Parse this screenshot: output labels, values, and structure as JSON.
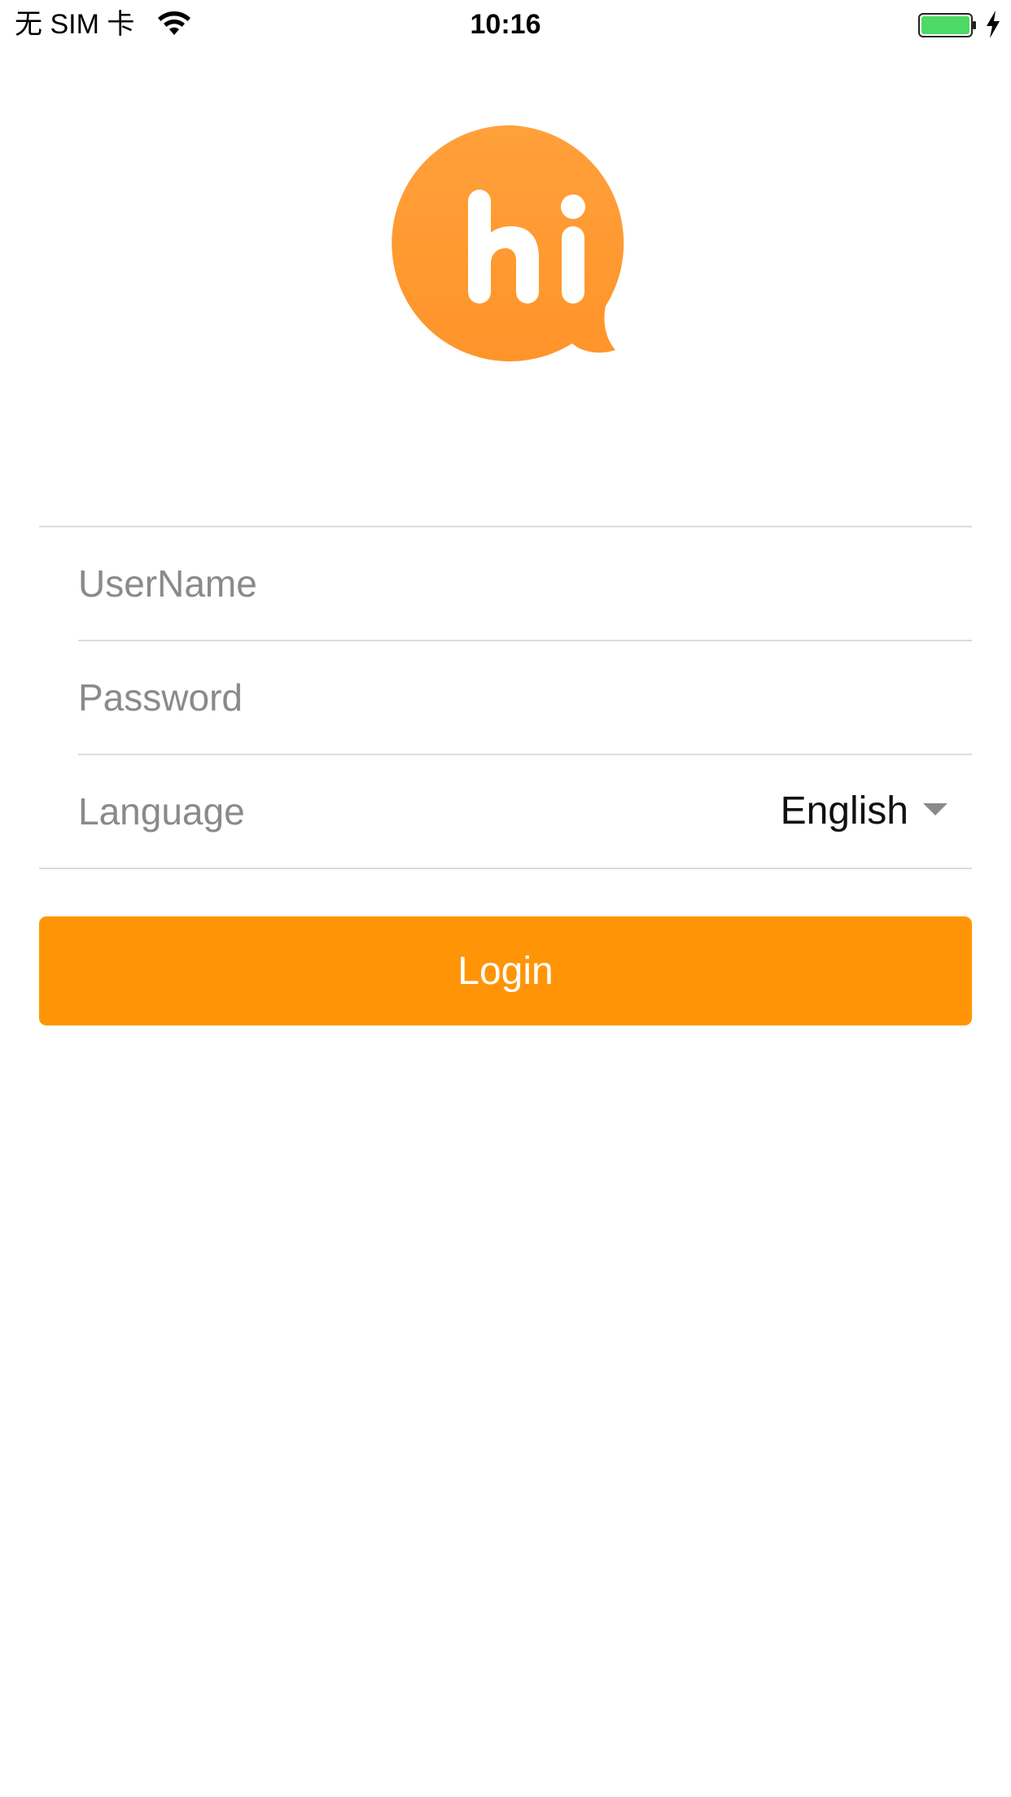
{
  "status_bar": {
    "carrier": "无 SIM 卡",
    "time": "10:16",
    "icons": [
      "wifi-icon",
      "battery-icon",
      "charging-icon"
    ],
    "battery_color": "#4cd964"
  },
  "logo": {
    "text": "hi",
    "color": "#ff9a2e"
  },
  "form": {
    "username_placeholder": "UserName",
    "password_placeholder": "Password",
    "language_label": "Language",
    "language_value": "English",
    "dropdown_icon": "chevron-down-icon"
  },
  "login_button": {
    "label": "Login",
    "color": "#ff9506"
  }
}
